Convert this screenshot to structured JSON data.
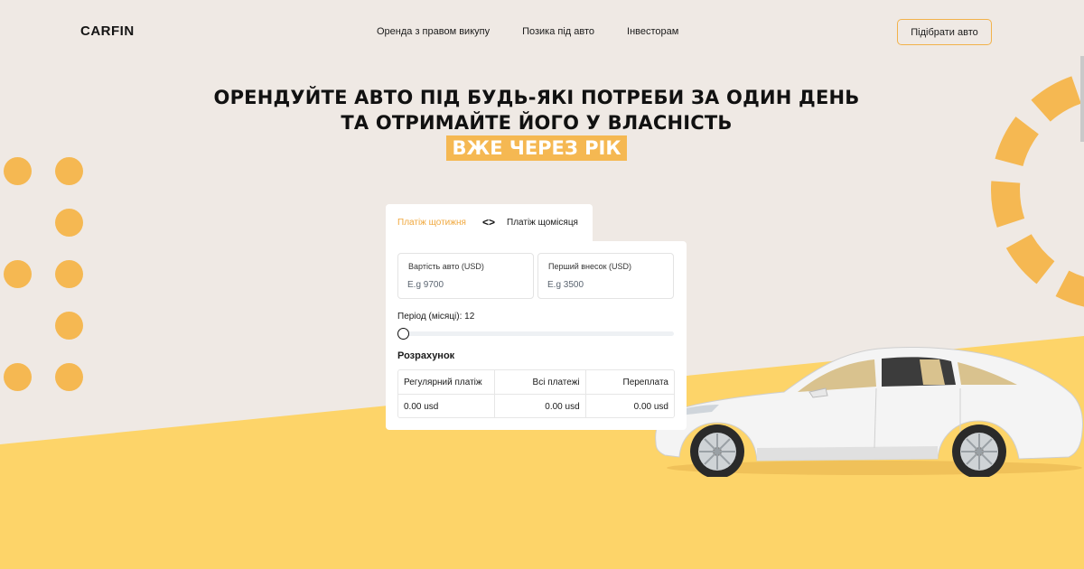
{
  "header": {
    "logo": "CARFIN",
    "nav": [
      "Оренда з правом викупу",
      "Позика під авто",
      "Інвесторам"
    ],
    "cta_label": "Підібрати авто"
  },
  "hero": {
    "line1": "ОРЕНДУЙТЕ АВТО ПІД БУДЬ-ЯКІ ПОТРЕБИ ЗА ОДИН ДЕНЬ",
    "line2": "ТА ОТРИМАЙТЕ ЙОГО У ВЛАСНІСТЬ",
    "highlight": "ВЖЕ ЧЕРЕЗ РІК"
  },
  "calculator": {
    "tabs": {
      "weekly": "Платіж щотижня",
      "toggle": "<>",
      "monthly": "Платіж щомісяця",
      "active": "weekly"
    },
    "car_price": {
      "label": "Вартість авто (USD)",
      "placeholder": "E.g 9700",
      "value": ""
    },
    "down_payment": {
      "label": "Перший внесок (USD)",
      "placeholder": "E.g 3500",
      "value": ""
    },
    "period_label": "Період (місяці): 12",
    "period_value": 12,
    "result_title": "Розрахунок",
    "columns": [
      "Регулярний платіж",
      "Всі платежі",
      "Переплата"
    ],
    "values": [
      "0.00 usd",
      "0.00 usd",
      "0.00 usd"
    ]
  },
  "colors": {
    "accent": "#f5b852",
    "background": "#efe9e4",
    "yellow_ground": "#fdd469"
  }
}
